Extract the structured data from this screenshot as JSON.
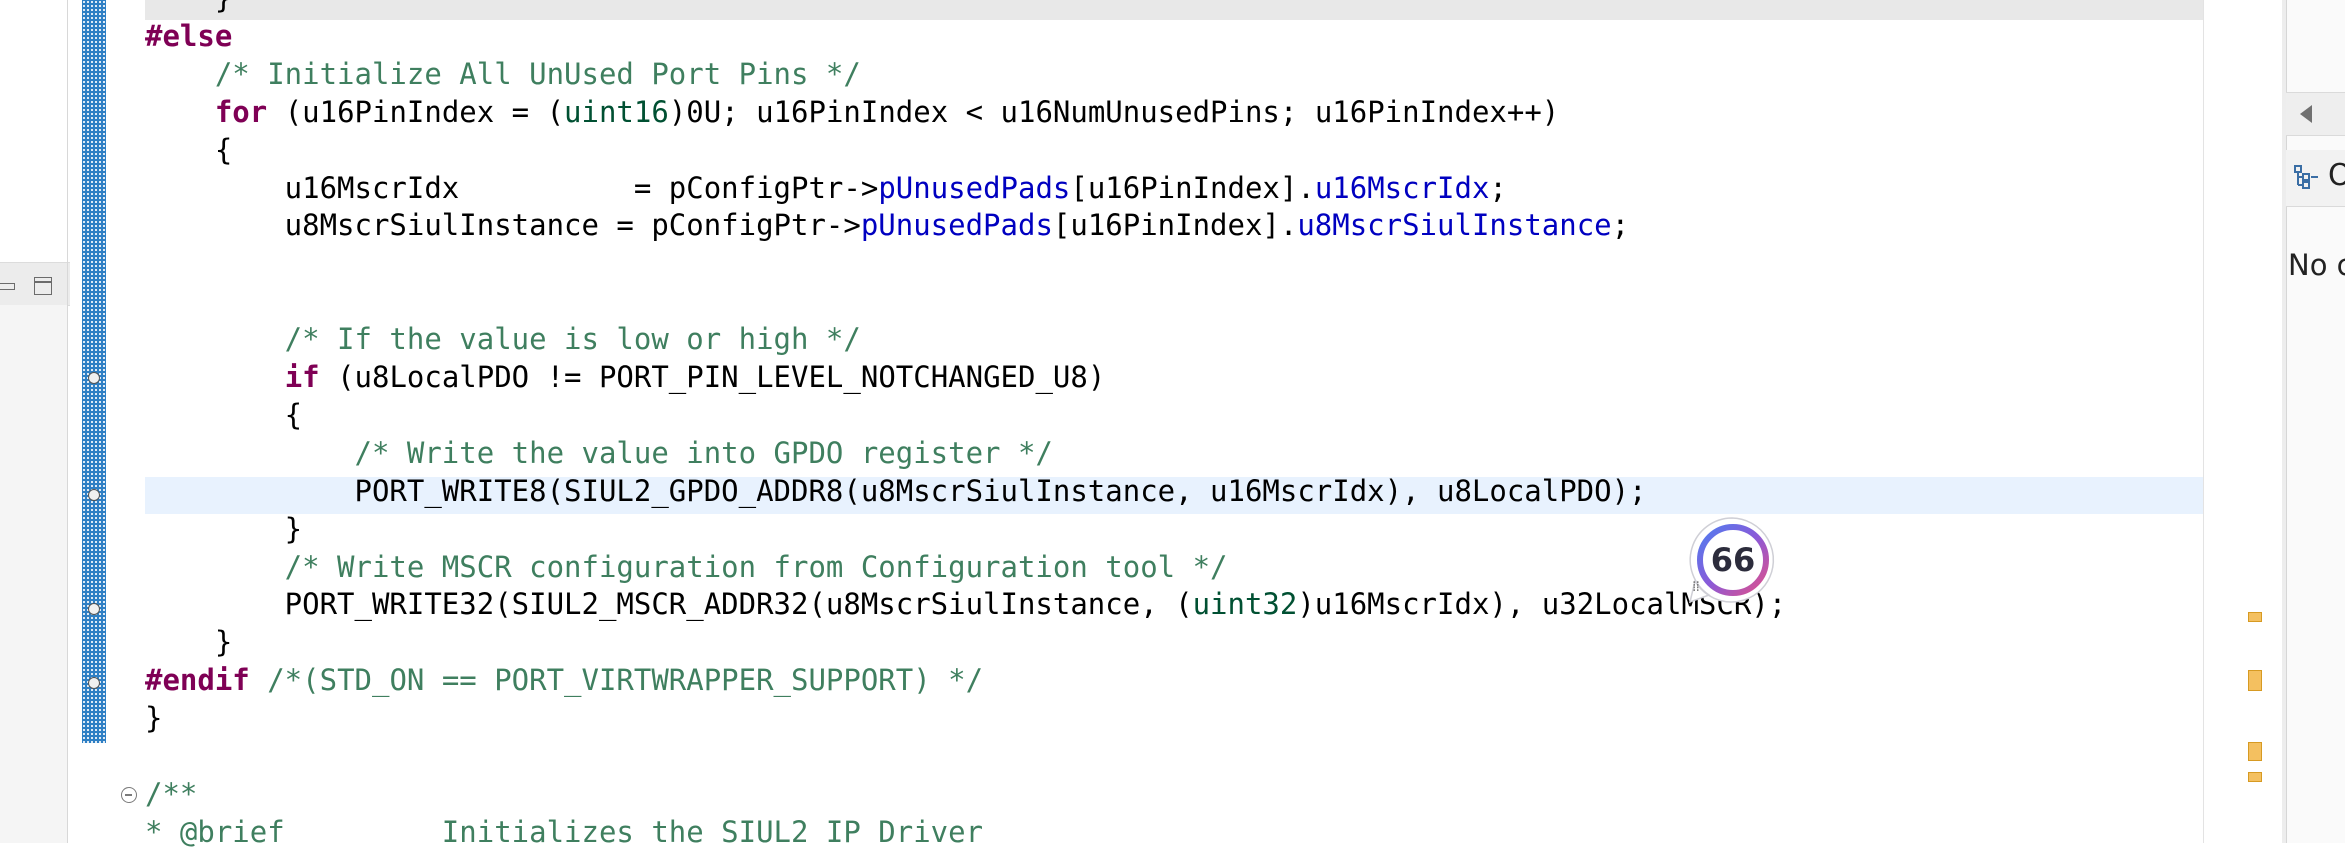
{
  "editor": {
    "lines": [
      {
        "id": "l0",
        "segments": [
          {
            "t": "    }",
            "c": "plain"
          }
        ]
      },
      {
        "id": "l1",
        "segments": [
          {
            "t": "#else",
            "c": "kw"
          }
        ]
      },
      {
        "id": "l2",
        "segments": [
          {
            "t": "    /* Initialize All UnUsed Port Pins */",
            "c": "cm"
          }
        ]
      },
      {
        "id": "l3",
        "segments": [
          {
            "t": "    ",
            "c": "plain"
          },
          {
            "t": "for",
            "c": "kw"
          },
          {
            "t": " (u16PinIndex = (",
            "c": "plain"
          },
          {
            "t": "uint16",
            "c": "typ"
          },
          {
            "t": ")0U; u16PinIndex < u16NumUnusedPins; u16PinIndex++)",
            "c": "plain"
          }
        ]
      },
      {
        "id": "l4",
        "segments": [
          {
            "t": "    {",
            "c": "plain"
          }
        ]
      },
      {
        "id": "l5",
        "segments": [
          {
            "t": "        u16MscrIdx          = pConfigPtr->",
            "c": "plain"
          },
          {
            "t": "pUnusedPads",
            "c": "fld"
          },
          {
            "t": "[u16PinIndex].",
            "c": "plain"
          },
          {
            "t": "u16MscrIdx",
            "c": "fld"
          },
          {
            "t": ";",
            "c": "plain"
          }
        ]
      },
      {
        "id": "l6",
        "segments": [
          {
            "t": "        u8MscrSiulInstance = pConfigPtr->",
            "c": "plain"
          },
          {
            "t": "pUnusedPads",
            "c": "fld"
          },
          {
            "t": "[u16PinIndex].",
            "c": "plain"
          },
          {
            "t": "u8MscrSiulInstance",
            "c": "fld"
          },
          {
            "t": ";",
            "c": "plain"
          }
        ]
      },
      {
        "id": "l7",
        "segments": [
          {
            "t": "",
            "c": "plain"
          }
        ]
      },
      {
        "id": "l8",
        "segments": [
          {
            "t": "",
            "c": "plain"
          }
        ]
      },
      {
        "id": "l9",
        "segments": [
          {
            "t": "        /* If the value is low or high */",
            "c": "cm"
          }
        ]
      },
      {
        "id": "l10",
        "segments": [
          {
            "t": "        ",
            "c": "plain"
          },
          {
            "t": "if",
            "c": "kw"
          },
          {
            "t": " (u8LocalPDO != PORT_PIN_LEVEL_NOTCHANGED_U8)",
            "c": "plain"
          }
        ]
      },
      {
        "id": "l11",
        "segments": [
          {
            "t": "        {",
            "c": "plain"
          }
        ]
      },
      {
        "id": "l12",
        "segments": [
          {
            "t": "            /* Write the value into GPDO register */",
            "c": "cm"
          }
        ]
      },
      {
        "id": "l13",
        "segments": [
          {
            "t": "            PORT_WRITE8(SIUL2_GPDO_ADDR8(u8MscrSiulInstance, u16MscrIdx), u8LocalPDO);",
            "c": "plain"
          }
        ]
      },
      {
        "id": "l14",
        "segments": [
          {
            "t": "        }",
            "c": "plain"
          }
        ]
      },
      {
        "id": "l15",
        "segments": [
          {
            "t": "        /* Write MSCR configuration from Configuration tool */",
            "c": "cm"
          }
        ]
      },
      {
        "id": "l16",
        "segments": [
          {
            "t": "        PORT_WRITE32(SIUL2_MSCR_ADDR32(u8MscrSiulInstance, (",
            "c": "plain"
          },
          {
            "t": "uint32",
            "c": "typ"
          },
          {
            "t": ")u16MscrIdx), u32LocalMSCR);",
            "c": "plain"
          }
        ]
      },
      {
        "id": "l17",
        "segments": [
          {
            "t": "    }",
            "c": "plain"
          }
        ]
      },
      {
        "id": "l18",
        "segments": [
          {
            "t": "#endif",
            "c": "kw"
          },
          {
            "t": " /*(STD_ON == PORT_VIRTWRAPPER_SUPPORT) */",
            "c": "cm"
          }
        ]
      },
      {
        "id": "l19",
        "segments": [
          {
            "t": "}",
            "c": "plain"
          }
        ]
      },
      {
        "id": "l20",
        "segments": [
          {
            "t": "",
            "c": "plain"
          }
        ]
      },
      {
        "id": "l21",
        "segments": [
          {
            "t": "/**",
            "c": "cm"
          }
        ]
      },
      {
        "id": "l22",
        "segments": [
          {
            "t": "* @brief         Initializes the SIUL2 IP Driver",
            "c": "cm"
          }
        ]
      }
    ]
  },
  "right_panel": {
    "title": "O",
    "no_content": "No c"
  },
  "badge": {
    "count": "66"
  },
  "colors": {
    "keyword": "#7f0055",
    "comment": "#3f7f5f",
    "field": "#0000c0",
    "type": "#005032",
    "current_line": "#e8f2fe"
  }
}
